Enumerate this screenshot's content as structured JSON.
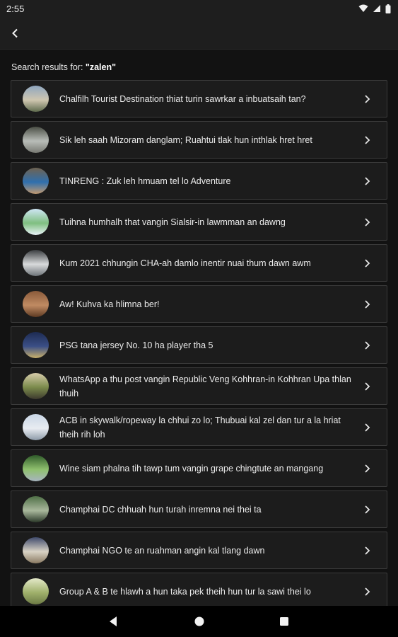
{
  "status": {
    "time": "2:55"
  },
  "search": {
    "prefix": "Search results for: ",
    "query": "\"zalen\""
  },
  "results": [
    {
      "title": "Chalfilh Tourist Destination thiat turin sawrkar a inbuatsaih tan?",
      "thumb_colors": [
        "#8fa6bf",
        "#cfc6b0",
        "#5e6b4d"
      ]
    },
    {
      "title": "Sik leh saah Mizoram danglam; Ruahtui tlak hun inthlak hret hret",
      "thumb_colors": [
        "#4b4f46",
        "#b9bdb8",
        "#787a73"
      ]
    },
    {
      "title": "TINRENG : Zuk leh hmuam tel lo Adventure",
      "thumb_colors": [
        "#6f6250",
        "#2f6fae",
        "#c29a70"
      ]
    },
    {
      "title": "Tuihna humhalh that vangin Sialsir-in lawmman an dawng",
      "thumb_colors": [
        "#cfe6f5",
        "#7fbf80",
        "#e9f3f8"
      ]
    },
    {
      "title": "Kum 2021 chhungin CHA-ah damlo inentir nuai thum dawn awm",
      "thumb_colors": [
        "#3a3d40",
        "#d8dadb",
        "#6e7479"
      ]
    },
    {
      "title": "Aw! Kuhva ka hlimna ber!",
      "thumb_colors": [
        "#8a5a3a",
        "#c08b63",
        "#5e3a22"
      ]
    },
    {
      "title": "PSG tana jersey No. 10 ha player tha 5",
      "thumb_colors": [
        "#1d2b52",
        "#3b4f86",
        "#c9b06a"
      ]
    },
    {
      "title": "WhatsApp a thu post vangin Republic Veng Kohhran-in Kohhran Upa thlan thuih",
      "thumb_colors": [
        "#d7ccaa",
        "#7a8a4b",
        "#3d3a2e"
      ]
    },
    {
      "title": "ACB in skywalk/ropeway la chhui zo lo; Thubuai kal zel dan tur a la hriat theih rih loh",
      "thumb_colors": [
        "#c9d6e6",
        "#e8ecf1",
        "#8d9aa8"
      ]
    },
    {
      "title": "Wine siam phalna tih tawp tum vangin grape chingtute an mangang",
      "thumb_colors": [
        "#2f5a2a",
        "#8fc06e",
        "#a8b5c0"
      ]
    },
    {
      "title": "Champhai DC chhuah hun turah inremna nei thei ta",
      "thumb_colors": [
        "#4e6f46",
        "#a9b89c",
        "#2c3a2a"
      ]
    },
    {
      "title": "Champhai NGO te an ruahman angin kal tlang dawn",
      "thumb_colors": [
        "#3f4a6b",
        "#d9d3c5",
        "#8a7a62"
      ]
    },
    {
      "title": "Group A & B te hlawh a hun taka pek theih hun tur la sawi thei lo",
      "thumb_colors": [
        "#e4e9c9",
        "#9fb06b",
        "#6c7a45"
      ]
    }
  ],
  "icons": {
    "back": "back-arrow-icon",
    "chevron": "chevron-right-icon"
  }
}
